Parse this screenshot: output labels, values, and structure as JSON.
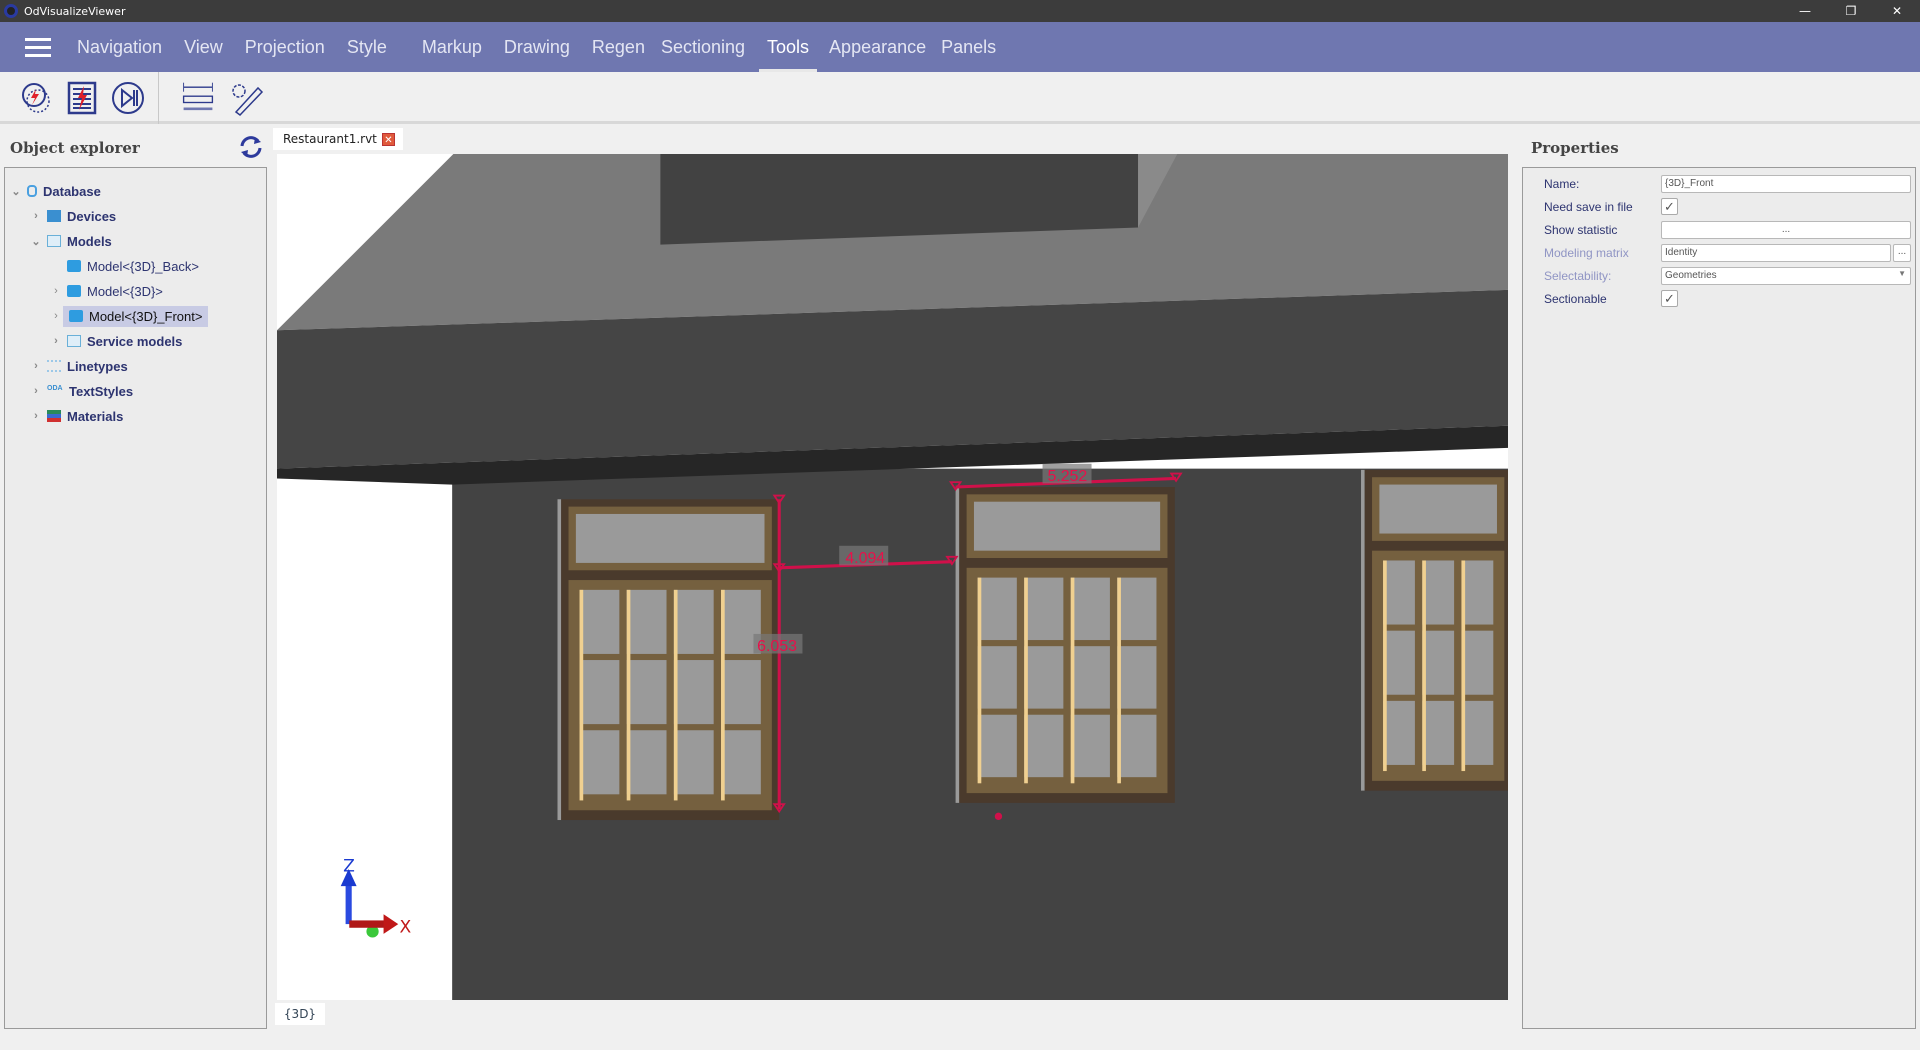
{
  "app": {
    "title": "OdVisualizeViewer",
    "window_controls": [
      "—",
      "❐",
      "✕"
    ]
  },
  "menu": {
    "items": [
      "Navigation",
      "View",
      "Projection",
      "Style",
      "Markup",
      "Drawing",
      "Regen",
      "Sectioning",
      "Tools",
      "Appearance",
      "Panels"
    ],
    "active": "Tools"
  },
  "toolbar": {
    "icons": [
      "zoom-extents-icon",
      "regen-icon",
      "animation-icon",
      "measure-distance-icon",
      "measure-settings-icon"
    ]
  },
  "object_explorer": {
    "title": "Object explorer",
    "tree": [
      {
        "label": "Database",
        "expanded": true
      },
      {
        "label": "Devices"
      },
      {
        "label": "Models",
        "expanded": true
      },
      {
        "label": "Model<{3D}_Back>"
      },
      {
        "label": "Model<{3D}>"
      },
      {
        "label": "Model<{3D}_Front>",
        "selected": true
      },
      {
        "label": "Service models"
      },
      {
        "label": "Linetypes"
      },
      {
        "label": "TextStyles",
        "icon_text": "ODA"
      },
      {
        "label": "Materials"
      }
    ]
  },
  "document": {
    "tab": "Restaurant1.rvt",
    "view_tab": "{3D}"
  },
  "viewport": {
    "measurements": [
      "6.053",
      "4.094",
      "5.252"
    ],
    "axes": {
      "z": "Z",
      "x": "X"
    },
    "measure_color": "#d0104a"
  },
  "properties": {
    "title": "Properties",
    "name_label": "Name:",
    "name_value": "{3D}_Front",
    "need_save_label": "Need save in file",
    "need_save_checked": true,
    "show_statistic_label": "Show statistic",
    "show_statistic_button": "...",
    "modeling_matrix_label": "Modeling matrix",
    "modeling_matrix_value": "Identity",
    "modeling_matrix_button": "...",
    "selectability_label": "Selectability:",
    "selectability_value": "Geometries",
    "sectionable_label": "Sectionable",
    "sectionable_checked": true,
    "check_mark": "✓"
  },
  "colors": {
    "menu_bg": "#6f77b0",
    "title_bg": "#3c3c3c",
    "selection": "#c8cbe4"
  }
}
